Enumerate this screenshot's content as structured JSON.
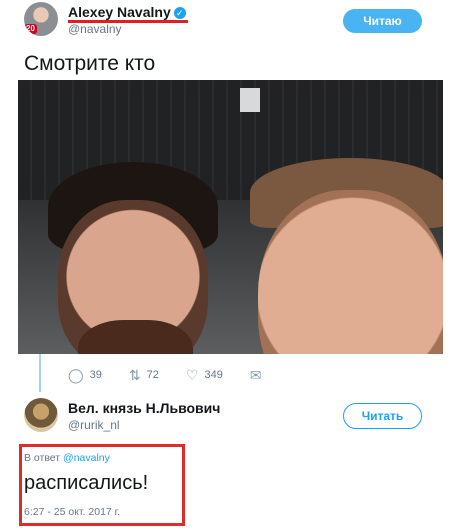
{
  "tweet": {
    "author": {
      "name": "Alexey Navalny",
      "handle": "@navalny",
      "verified_icon": "check-icon",
      "avatar_badge": "20"
    },
    "follow_label": "Читаю",
    "text": "Смотрите кто",
    "stats": {
      "replies": "39",
      "retweets": "72",
      "likes": "349"
    }
  },
  "reply": {
    "author": {
      "name": "Вел. князь Н.Львович",
      "handle": "@rurik_nl"
    },
    "follow_label": "Читать",
    "reply_to_prefix": "В ответ",
    "reply_to_mention": "@navalny",
    "text": "расписались!",
    "timestamp": "6:27 - 25 окт. 2017 г."
  },
  "colors": {
    "accent": "#1da1f2",
    "highlight_border": "#e12a2a",
    "secondary_text": "#657786"
  }
}
